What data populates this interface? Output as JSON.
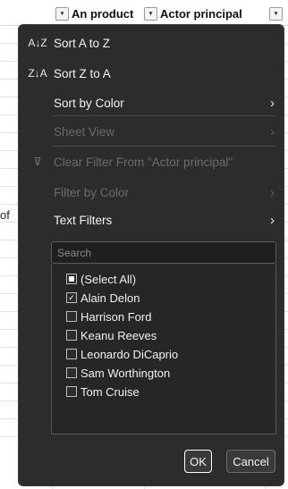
{
  "header": {
    "col1_label": "An product",
    "col2_label": "Actor principal",
    "dropdown_glyph": "▾"
  },
  "sheet": {
    "partial_cell_text": "of"
  },
  "menu": {
    "items": [
      {
        "icon": "sort-az-icon",
        "icon_glyph": "A↓Z",
        "label": "Sort A to Z",
        "enabled": true
      },
      {
        "icon": "sort-za-icon",
        "icon_glyph": "Z↓A",
        "label": "Sort Z to A",
        "enabled": true
      },
      {
        "label": "Sort by Color",
        "enabled": true,
        "submenu": true
      },
      {
        "label": "Sheet View",
        "enabled": false,
        "submenu": true
      },
      {
        "icon": "clear-filter-icon",
        "icon_glyph": "⊽",
        "label": "Clear Filter From \"Actor principal\"",
        "enabled": false
      },
      {
        "label": "Filter by Color",
        "enabled": false,
        "submenu": true
      },
      {
        "label": "Text Filters",
        "enabled": true,
        "submenu": true
      }
    ],
    "chevron_glyph": "›",
    "search": {
      "placeholder": "Search"
    },
    "list": [
      {
        "label": "(Select All)",
        "state": "partial"
      },
      {
        "label": "Alain Delon",
        "state": "checked"
      },
      {
        "label": "Harrison Ford",
        "state": "unchecked"
      },
      {
        "label": "Keanu Reeves",
        "state": "unchecked"
      },
      {
        "label": "Leonardo DiCaprio",
        "state": "unchecked"
      },
      {
        "label": "Sam Worthington",
        "state": "unchecked"
      },
      {
        "label": "Tom Cruise",
        "state": "unchecked"
      }
    ],
    "check_glyph": "✓",
    "ok_label": "OK",
    "cancel_label": "Cancel"
  },
  "colors": {
    "menu_bg": "#2c2c2c",
    "menu_text": "#f2f2f2",
    "disabled_text": "#6b6b6b"
  }
}
